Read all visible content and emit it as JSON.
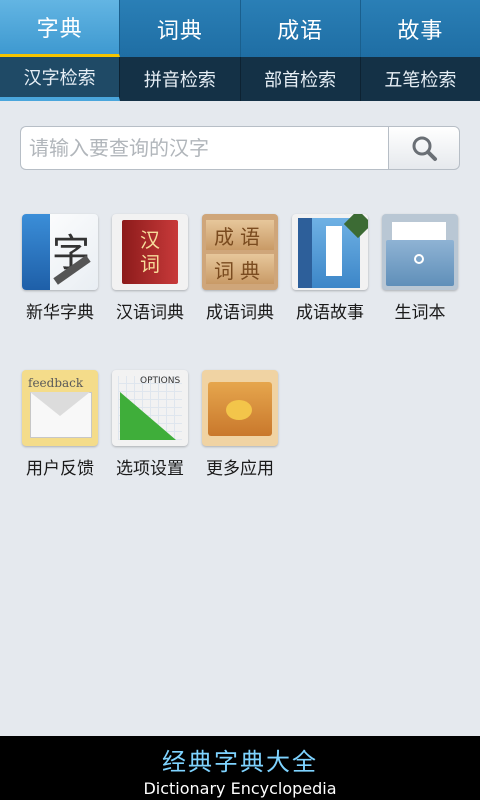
{
  "top_tabs": [
    {
      "label": "字典"
    },
    {
      "label": "词典"
    },
    {
      "label": "成语"
    },
    {
      "label": "故事"
    }
  ],
  "sub_tabs": [
    {
      "label": "汉字检索"
    },
    {
      "label": "拼音检索"
    },
    {
      "label": "部首检索"
    },
    {
      "label": "五笔检索"
    }
  ],
  "search": {
    "placeholder": "请输入要查询的汉字",
    "value": ""
  },
  "apps": [
    {
      "label": "新华字典",
      "icon": "dictionary-book-icon",
      "glyph": "字"
    },
    {
      "label": "汉语词典",
      "icon": "red-book-icon",
      "glyph1": "汉",
      "glyph2": "词"
    },
    {
      "label": "成语词典",
      "icon": "idiom-board-icon",
      "glyph1": "成语",
      "glyph2": "词典"
    },
    {
      "label": "成语故事",
      "icon": "story-book-icon"
    },
    {
      "label": "生词本",
      "icon": "vocab-folder-icon"
    },
    {
      "label": "用户反馈",
      "icon": "feedback-mail-icon",
      "glyph": "feedback"
    },
    {
      "label": "选项设置",
      "icon": "options-ruler-icon",
      "glyph": "OPTIONS"
    },
    {
      "label": "更多应用",
      "icon": "more-apps-folder-icon"
    }
  ],
  "footer": {
    "title_cn": "经典字典大全",
    "title_en": "Dictionary Encyclopedia"
  },
  "colors": {
    "top_tab_bg": "#2a7fb6",
    "active_tab": "#3e99d0",
    "active_indicator": "#f5c400",
    "sub_tab_bg": "#143146",
    "footer_title": "#7ed3ff"
  }
}
